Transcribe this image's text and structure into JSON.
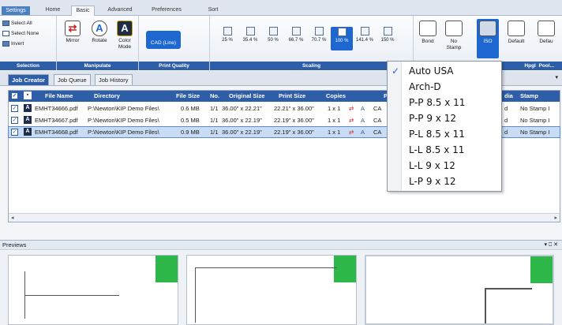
{
  "tabs": [
    "Settings",
    "Home",
    "Basic",
    "Advanced",
    "Preferences",
    "Sort"
  ],
  "ribbon": {
    "selection": {
      "items": [
        "Select All",
        "Select None",
        "Invert"
      ],
      "label": "Selection"
    },
    "manipulate": {
      "items": [
        "Mirror",
        "Rotate",
        "Color Mode"
      ],
      "label": "Manipulate"
    },
    "print_quality": {
      "button": "CAD (Line)",
      "label": "Print Quality"
    },
    "scaling": {
      "options": [
        "25 %",
        "35.4 %",
        "50 %",
        "66.7 %",
        "70.7 %",
        "100 %",
        "141.4 %",
        "150 %"
      ],
      "active": "100 %",
      "label": "Scaling"
    },
    "bond": "Bond",
    "stamp": "No Stamp",
    "iso": "ISO",
    "default1": "Default",
    "default2": "Defau",
    "hpgl": "Hpgl",
    "pool": "Pool..."
  },
  "job_tabs": [
    "Job Creator",
    "Job Queue",
    "Job History"
  ],
  "table": {
    "headers": [
      "File Name",
      "Directory",
      "File Size",
      "No.",
      "Original Size",
      "Print Size",
      "Copies",
      "P",
      "dia",
      "Stamp"
    ],
    "rows": [
      {
        "file": "EMHT34666.pdf",
        "dir": "P:\\Newton\\KIP Demo Files\\",
        "size": "0.6 MB",
        "no": "1/1",
        "orig": "36.00\" x 22.21\"",
        "print": "22.21\" x 36.00\"",
        "copies": "1 x 1",
        "p": "CA",
        "media": "d",
        "stamp": "No Stamp I"
      },
      {
        "file": "EMHT34667.pdf",
        "dir": "P:\\Newton\\KIP Demo Files\\",
        "size": "0.5 MB",
        "no": "1/1",
        "orig": "36.00\" x 22.19\"",
        "print": "22.19\" x 36.00\"",
        "copies": "1 x 1",
        "p": "CA",
        "media": "d",
        "stamp": "No Stamp I"
      },
      {
        "file": "EMHT34668.pdf",
        "dir": "P:\\Newton\\KIP Demo Files\\",
        "size": "0.9 MB",
        "no": "1/1",
        "orig": "36.00\" x 22.19\"",
        "print": "22.19\" x 36.00\"",
        "copies": "1 x 1",
        "p": "CA",
        "media": "d",
        "stamp": "No Stamp I"
      }
    ]
  },
  "previews": {
    "title": "Previews",
    "controls": "▾ ⎕ ✕"
  },
  "dropdown": {
    "selected": "Auto USA",
    "items": [
      "Auto USA",
      "Arch-D",
      "P-P  8.5 x 11",
      "P-P  9 x 12",
      "P-L  8.5 x 11",
      "L-L  8.5 x 11",
      "L-L  9 x 12",
      "L-P  9 x 12"
    ]
  }
}
